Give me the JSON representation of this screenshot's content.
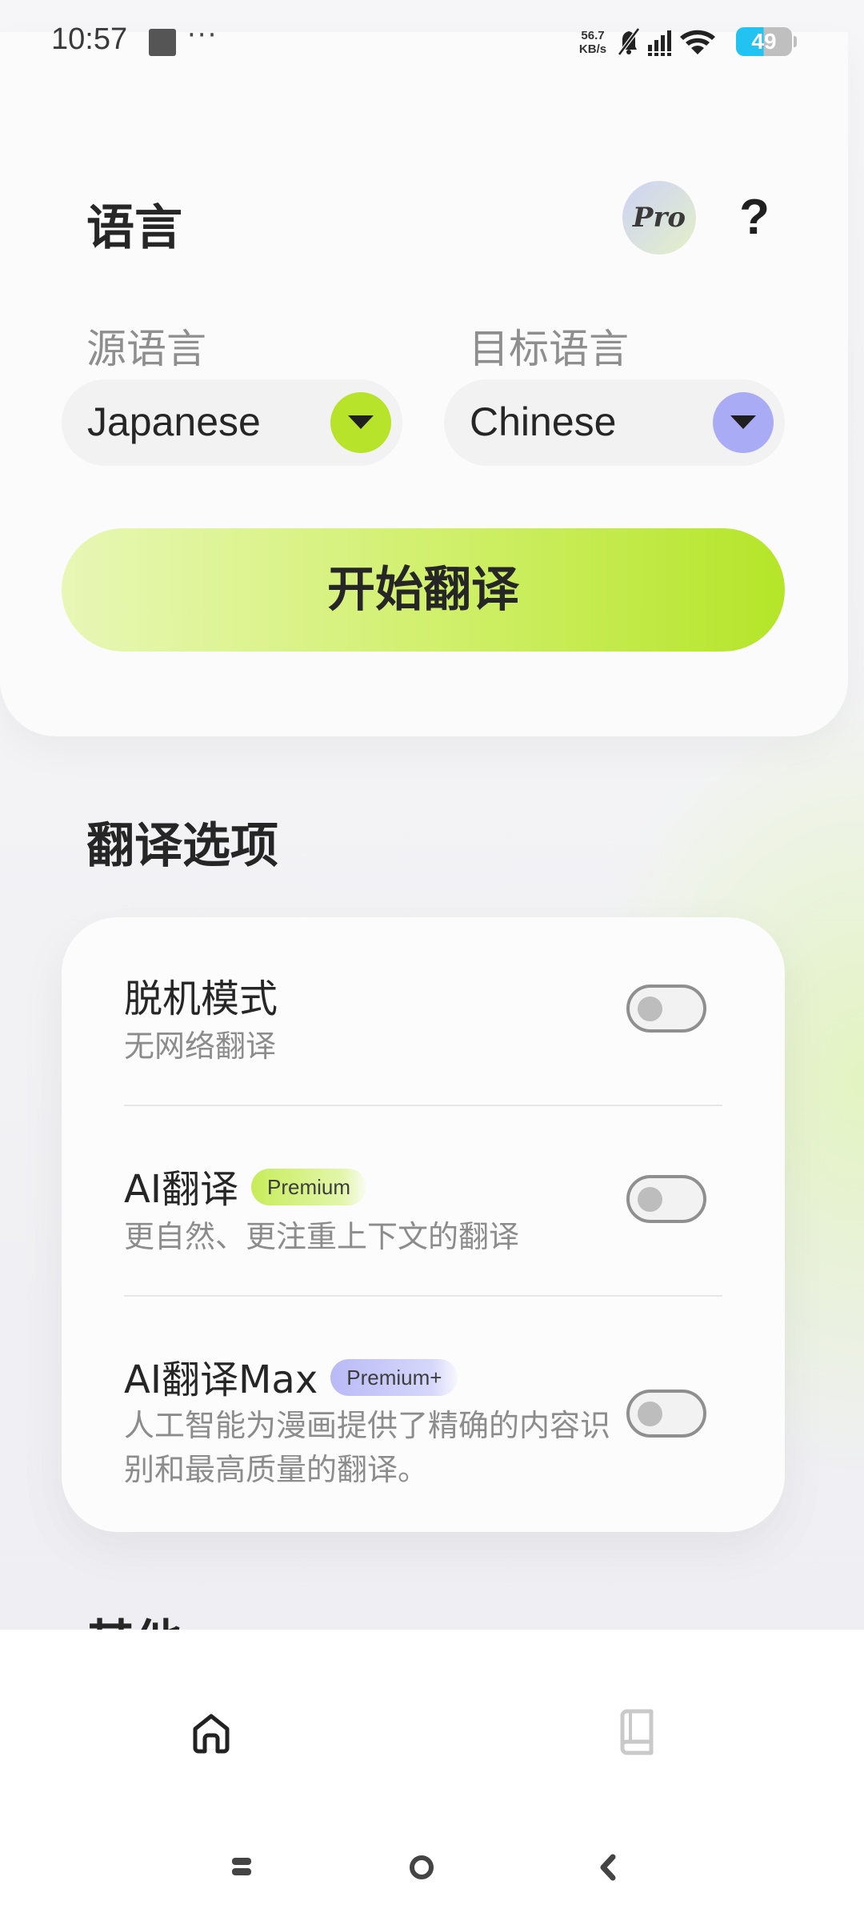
{
  "status_bar": {
    "time": "10:57",
    "more": "···",
    "net_speed_value": "56.7",
    "net_speed_unit": "KB/s",
    "battery": "49",
    "icons": [
      "notification-square-icon",
      "bell-off-icon",
      "signal-icon",
      "wifi-icon",
      "battery-icon"
    ]
  },
  "language_section": {
    "title": "语言",
    "pro_label": "Pro",
    "help_label": "?",
    "source_label": "源语言",
    "target_label": "目标语言",
    "source_value": "Japanese",
    "target_value": "Chinese",
    "translate_button": "开始翻译"
  },
  "options_section": {
    "title": "翻译选项",
    "items": [
      {
        "title": "脱机模式",
        "subtitle": "无网络翻译",
        "badge": "",
        "enabled": false
      },
      {
        "title": "AI翻译",
        "subtitle": "更自然、更注重上下文的翻译",
        "badge": "Premium",
        "enabled": false
      },
      {
        "title": "AI翻译Max",
        "subtitle": "人工智能为漫画提供了精确的内容识别和最高质量的翻译。",
        "badge": "Premium+",
        "enabled": false
      }
    ]
  },
  "other_section": {
    "title": "其他"
  },
  "bottom_nav": {
    "items": [
      "home-icon",
      "book-icon"
    ],
    "active": "home-icon"
  },
  "colors": {
    "accent_green": "#b7e42a",
    "accent_purple": "#a9abf5",
    "text_primary": "#262626",
    "text_secondary": "#8c8c8c"
  }
}
